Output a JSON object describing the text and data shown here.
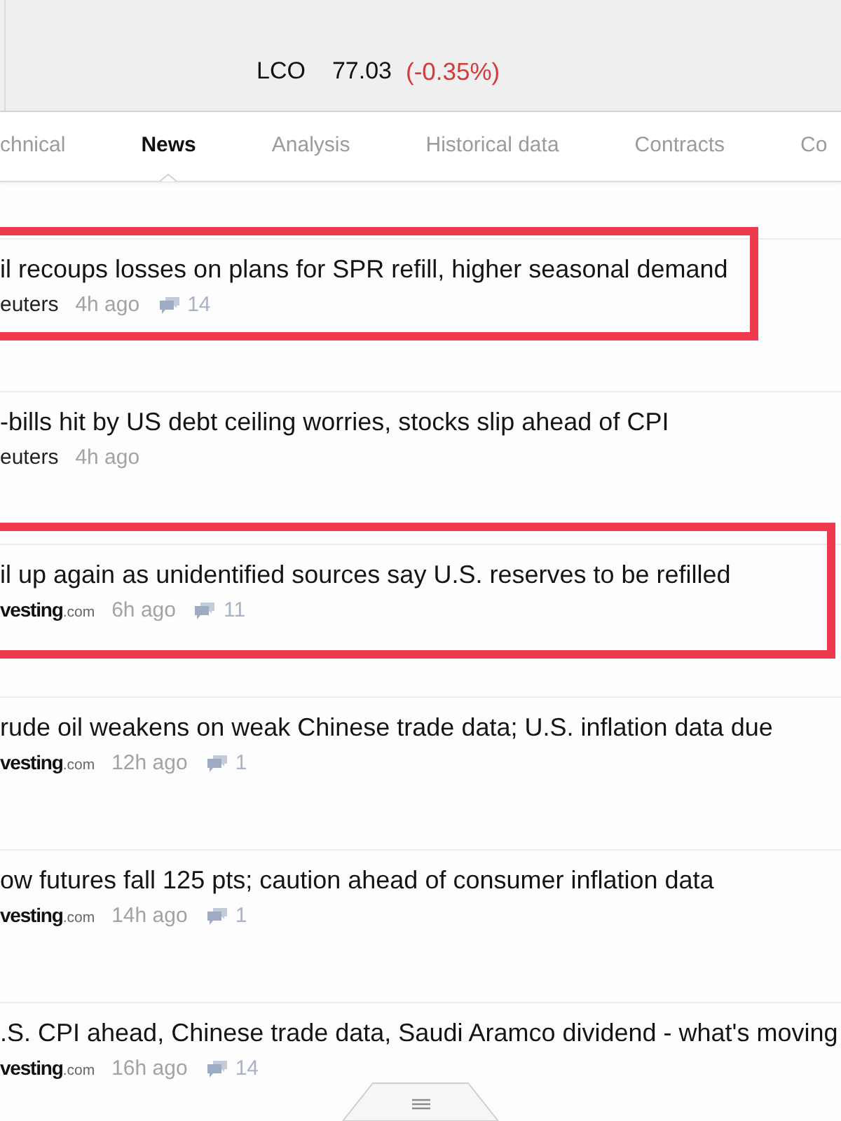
{
  "quote": {
    "symbol": "LCO",
    "price": "77.03",
    "change": "(-0.35%)",
    "negative": true
  },
  "tabs": [
    {
      "label": "chnical",
      "selected": false
    },
    {
      "label": "News",
      "selected": true
    },
    {
      "label": "Analysis",
      "selected": false
    },
    {
      "label": "Historical data",
      "selected": false
    },
    {
      "label": "Contracts",
      "selected": false
    },
    {
      "label": "Co",
      "selected": false
    }
  ],
  "news": [
    {
      "title": "il recoups losses on plans for SPR refill, higher seasonal demand",
      "source": {
        "kind": "text",
        "name": "euters"
      },
      "time": "4h ago",
      "comments": "14",
      "highlighted": true
    },
    {
      "title": "-bills hit by US debt ceiling worries, stocks slip ahead of CPI",
      "source": {
        "kind": "text",
        "name": "euters"
      },
      "time": "4h ago",
      "highlighted": false
    },
    {
      "title": "il up again as unidentified sources say U.S. reserves to be refilled",
      "source": {
        "kind": "logo",
        "name": "vesting",
        "suffix": ".com"
      },
      "time": "6h ago",
      "comments": "11",
      "highlighted": true
    },
    {
      "title": "rude oil weakens on weak Chinese trade data; U.S. inflation data due",
      "source": {
        "kind": "logo",
        "name": "vesting",
        "suffix": ".com"
      },
      "time": "12h ago",
      "comments": "1",
      "highlighted": false
    },
    {
      "title": "ow futures fall 125 pts; caution ahead of consumer inflation data",
      "source": {
        "kind": "logo",
        "name": "vesting",
        "suffix": ".com"
      },
      "time": "14h ago",
      "comments": "1",
      "highlighted": false
    },
    {
      "title": ".S. CPI ahead, Chinese trade data, Saudi Aramco dividend - what's moving",
      "source": {
        "kind": "logo",
        "name": "vesting",
        "suffix": ".com"
      },
      "time": "16h ago",
      "comments": "14",
      "highlighted": false
    }
  ]
}
